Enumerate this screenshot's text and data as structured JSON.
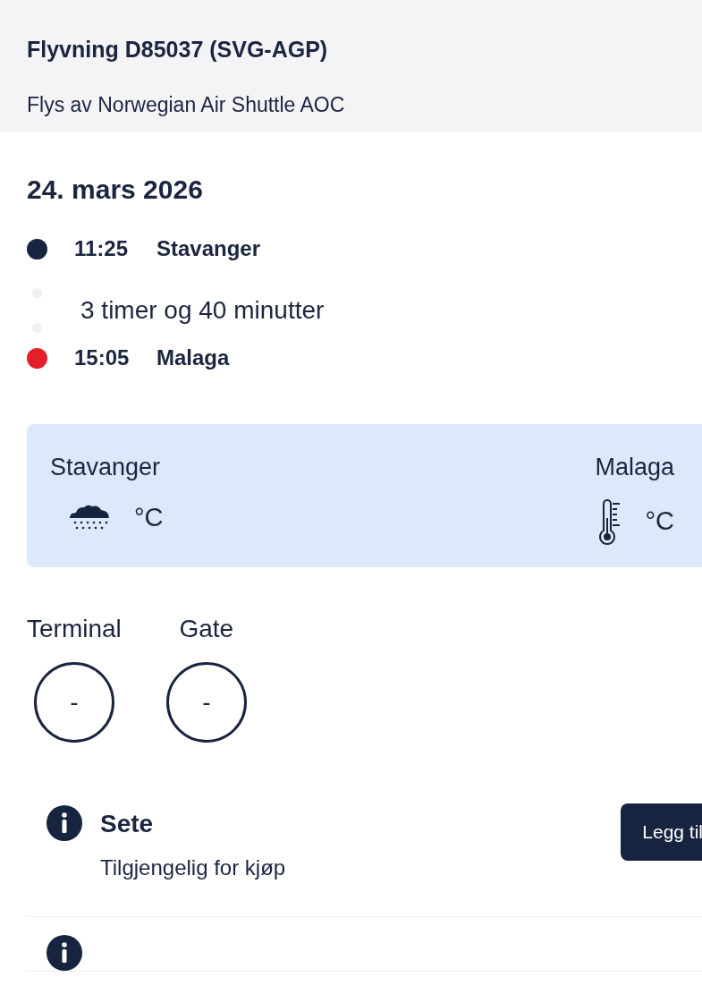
{
  "flight": {
    "title": "Flyvning D85037 (SVG-AGP)",
    "operator": "Flys av Norwegian Air Shuttle AOC"
  },
  "date": "24. mars 2026",
  "timeline": [
    {
      "kind": "stop",
      "time": "11:25",
      "place": "Stavanger",
      "color": "#17243f"
    },
    {
      "kind": "duration",
      "text": "3 timer og 40 minutter"
    },
    {
      "kind": "stop",
      "time": "15:05",
      "place": "Malaga",
      "color": "#e3202a"
    }
  ],
  "weather": [
    {
      "city": "Stavanger",
      "kind": "rain",
      "unit": "°C"
    },
    {
      "city": "Malaga",
      "kind": "thermometer",
      "unit": "°C"
    }
  ],
  "gates": [
    {
      "label": "Terminal",
      "value": "-"
    },
    {
      "label": "Gate",
      "value": "-"
    }
  ],
  "extras": [
    {
      "kind": "info",
      "title": "Sete",
      "text": "Tilgjengelig for kjøp",
      "button": "Legg til"
    },
    {
      "kind": "info"
    }
  ]
}
